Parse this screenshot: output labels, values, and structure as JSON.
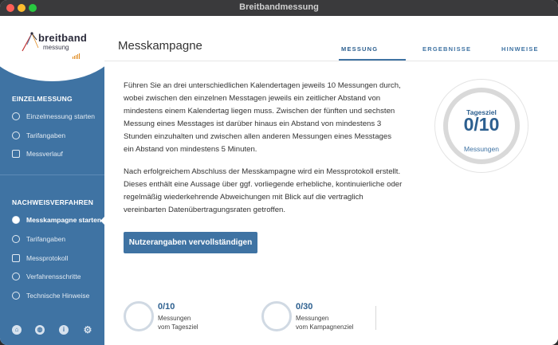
{
  "window": {
    "title": "Breitbandmessung"
  },
  "logo": {
    "main": "breitband",
    "sub": "messung"
  },
  "sidebar": {
    "section1": {
      "title": "EINZELMESSUNG",
      "items": [
        {
          "label": "Einzelmessung starten",
          "icon": "play-circle-icon"
        },
        {
          "label": "Tarifangaben",
          "icon": "user-tariff-icon"
        },
        {
          "label": "Messverlauf",
          "icon": "history-icon"
        }
      ]
    },
    "section2": {
      "title": "NACHWEISVERFAHREN",
      "items": [
        {
          "label": "Messkampagne starten",
          "icon": "play-circle-icon",
          "active": true
        },
        {
          "label": "Tarifangaben",
          "icon": "user-tariff-icon"
        },
        {
          "label": "Messprotokoll",
          "icon": "protocol-icon"
        },
        {
          "label": "Verfahrensschritte",
          "icon": "list-icon"
        },
        {
          "label": "Technische Hinweise",
          "icon": "warning-icon"
        }
      ]
    },
    "footer_icons": [
      "home-icon",
      "globe-icon",
      "info-icon",
      "settings-icon"
    ]
  },
  "main": {
    "title": "Messkampagne",
    "tabs": [
      {
        "label": "MESSUNG",
        "active": true
      },
      {
        "label": "ERGEBNISSE"
      },
      {
        "label": "HINWEISE"
      }
    ],
    "paragraph1": "Führen Sie an drei unterschiedlichen Kalendertagen jeweils 10 Messungen durch, wobei zwischen den einzelnen Messtagen jeweils ein zeitlicher Abstand von mindestens einem Kalendertag liegen muss. Zwischen der fünften und sechsten Messung eines Messtages ist darüber hinaus ein Abstand von mindestens 3 Stunden einzuhalten und zwischen allen anderen Messungen eines Messtages ein Abstand von mindestens 5 Minuten.",
    "paragraph2": "Nach erfolgreichem Abschluss der Messkampagne wird ein Messprotokoll erstellt. Dieses enthält eine Aussage über ggf. vorliegende erhebliche, kontinuierliche oder regelmäßig wiederkehrende Abweichungen mit Blick auf die vertraglich vereinbarten Datenübertragungsraten getroffen.",
    "cta_label": "Nutzerangaben vervollständigen",
    "gauge": {
      "label_top": "Tagesziel",
      "value": "0/10",
      "label_bottom": "Messungen"
    },
    "stats": [
      {
        "value": "0/10",
        "line1": "Messungen",
        "line2": "vom Tagesziel"
      },
      {
        "value": "0/30",
        "line1": "Messungen",
        "line2": "vom Kampagnenziel"
      }
    ]
  },
  "colors": {
    "sidebar": "#3f73a3",
    "accent": "#2c5f8f",
    "logo_accent": "#e08a1e"
  }
}
